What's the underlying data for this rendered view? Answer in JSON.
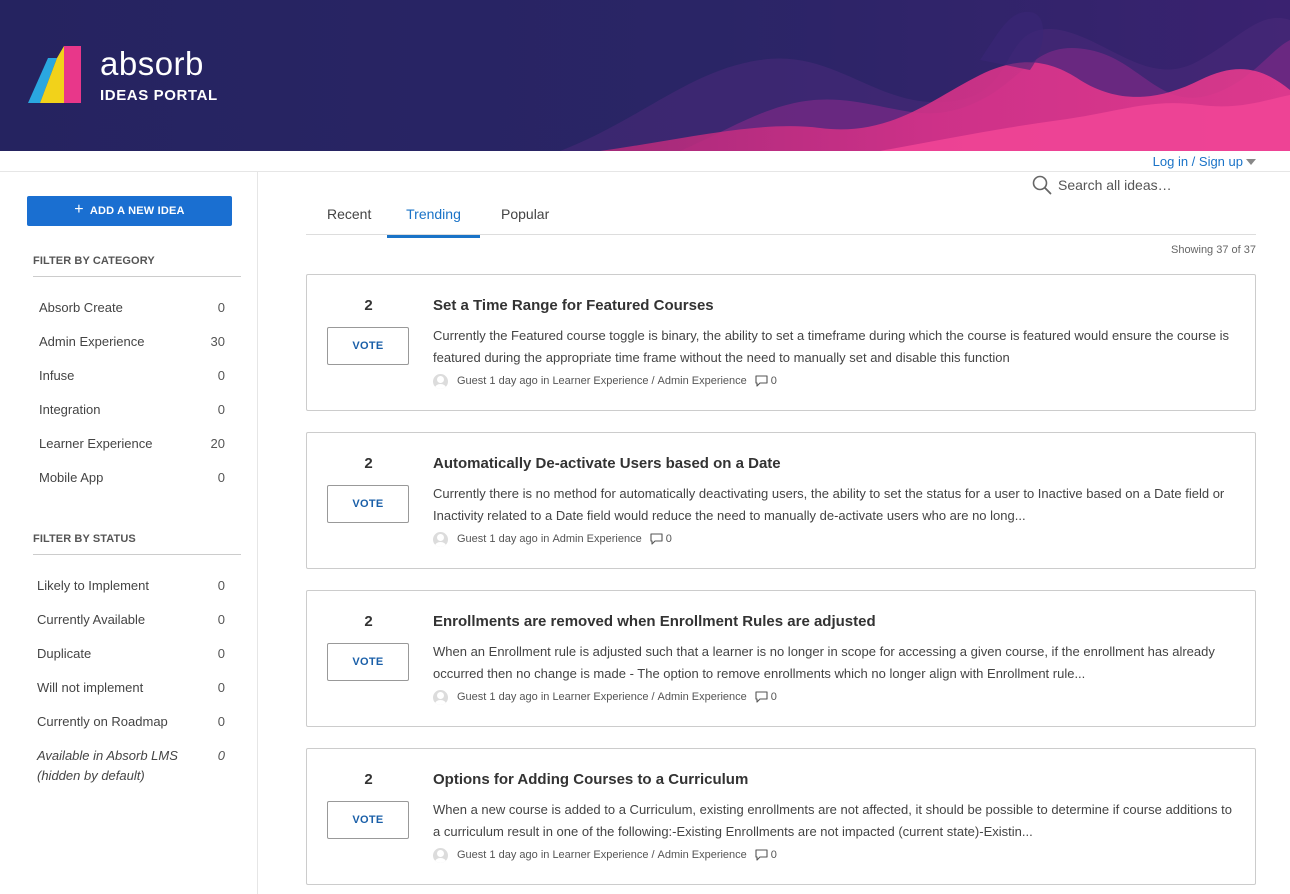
{
  "brand": {
    "name": "absorb",
    "subtitle": "IDEAS PORTAL",
    "colors": {
      "header_bg": "#262463",
      "wave_pink": "#e8378a",
      "accent": "#1a73c7"
    }
  },
  "auth": {
    "login_label": "Log in / Sign up"
  },
  "sidebar": {
    "add_button_label": "ADD A NEW IDEA",
    "category_title": "FILTER BY CATEGORY",
    "categories": [
      {
        "label": "Absorb Create",
        "count": "0"
      },
      {
        "label": "Admin Experience",
        "count": "30"
      },
      {
        "label": "Infuse",
        "count": "0"
      },
      {
        "label": "Integration",
        "count": "0"
      },
      {
        "label": "Learner Experience",
        "count": "20"
      },
      {
        "label": "Mobile App",
        "count": "0"
      }
    ],
    "status_title": "FILTER BY STATUS",
    "statuses": [
      {
        "label": "Likely to Implement",
        "count": "0"
      },
      {
        "label": "Currently Available",
        "count": "0"
      },
      {
        "label": "Duplicate",
        "count": "0"
      },
      {
        "label": "Will not implement",
        "count": "0"
      },
      {
        "label": "Currently on Roadmap",
        "count": "0"
      },
      {
        "label": "Available in Absorb LMS (hidden by default)",
        "count": "0"
      }
    ]
  },
  "tabs": [
    {
      "label": "Recent",
      "active": false
    },
    {
      "label": "Trending",
      "active": true
    },
    {
      "label": "Popular",
      "active": false
    }
  ],
  "search": {
    "placeholder": "Search all ideas…"
  },
  "showing": "Showing 37 of 37",
  "vote_label": "VOTE",
  "ideas": [
    {
      "votes": "2",
      "title": "Set a Time Range for Featured Courses",
      "description": "Currently the Featured course toggle is binary, the ability to set a timeframe during which the course is featured would ensure the course is featured during the appropriate time frame without the need to manually set and disable this function",
      "author": "Guest",
      "time": "1 day ago",
      "in": "in",
      "categories": [
        "Learner Experience",
        "Admin Experience"
      ],
      "comments": "0"
    },
    {
      "votes": "2",
      "title": "Automatically De-activate Users based on a Date",
      "description": "Currently there is no method for automatically deactivating users, the ability to set the status for a user to Inactive based on a Date field or Inactivity related to a Date field would reduce the need to manually de-activate users who are no long...",
      "author": "Guest",
      "time": "1 day ago",
      "in": "in",
      "categories": [
        "Admin Experience"
      ],
      "comments": "0"
    },
    {
      "votes": "2",
      "title": "Enrollments are removed when Enrollment Rules are adjusted",
      "description": "When an Enrollment rule is adjusted such that a learner is no longer in scope for accessing a given course, if the enrollment has already occurred then no change is made - The option to remove enrollments which no longer align with Enrollment rule...",
      "author": "Guest",
      "time": "1 day ago",
      "in": "in",
      "categories": [
        "Learner Experience",
        "Admin Experience"
      ],
      "comments": "0"
    },
    {
      "votes": "2",
      "title": "Options for Adding Courses to a Curriculum",
      "description": "When a new course is added to a Curriculum, existing enrollments are not affected, it should be possible to determine if course additions to a curriculum result in one of the following:-Existing Enrollments are not impacted (current state)-Existin...",
      "author": "Guest",
      "time": "1 day ago",
      "in": "in",
      "categories": [
        "Learner Experience",
        "Admin Experience"
      ],
      "comments": "0"
    }
  ]
}
